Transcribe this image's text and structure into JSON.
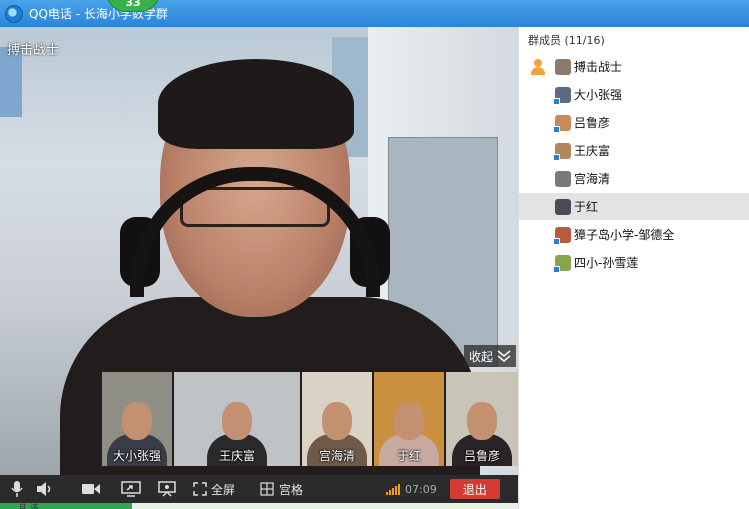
{
  "window": {
    "title": "QQ电话 - 长海小学数学群",
    "member_badge": "33"
  },
  "main_video": {
    "speaker_name": "搏击战士",
    "collapse_label": "收起"
  },
  "thumbnails": [
    {
      "name": "大小张强",
      "bg": "#8f8f86",
      "shirt": "#3a3d47"
    },
    {
      "name": "王庆富",
      "bg": "#bfc3c6",
      "shirt": "#2a2a2c"
    },
    {
      "name": "宫海清",
      "bg": "#d9d2c5",
      "shirt": "#6d5a48"
    },
    {
      "name": "于红",
      "bg": "#c9903f",
      "shirt": "#c8a9a0"
    },
    {
      "name": "吕鲁彦",
      "bg": "#c9c4b8",
      "shirt": "#2a2426"
    }
  ],
  "toolbar": {
    "fullscreen_label": "全屏",
    "grid_label": "宫格",
    "timer": "07:09",
    "exit_label": "退出"
  },
  "statusbar": {
    "partial_text": "且 该"
  },
  "members_panel": {
    "title": "群成员 (11/16)",
    "members": [
      {
        "name": "搏击战士",
        "avatar": "#8c7a6a",
        "host": true,
        "selected": false
      },
      {
        "name": "大小张强",
        "avatar": "#5b6c80",
        "host": false,
        "selected": false
      },
      {
        "name": "吕鲁彦",
        "avatar": "#c88a56",
        "host": false,
        "selected": false
      },
      {
        "name": "王庆富",
        "avatar": "#b3865f",
        "host": false,
        "selected": false
      },
      {
        "name": "宫海清",
        "avatar": "#7a7a7a",
        "host": false,
        "selected": false
      },
      {
        "name": "于红",
        "avatar": "#4a4a55",
        "host": false,
        "selected": true
      },
      {
        "name": "獐子岛小学-邹德全",
        "avatar": "#b85b3e",
        "host": false,
        "selected": false
      },
      {
        "name": "四小-孙雪莲",
        "avatar": "#8aa34d",
        "host": false,
        "selected": false
      }
    ]
  }
}
